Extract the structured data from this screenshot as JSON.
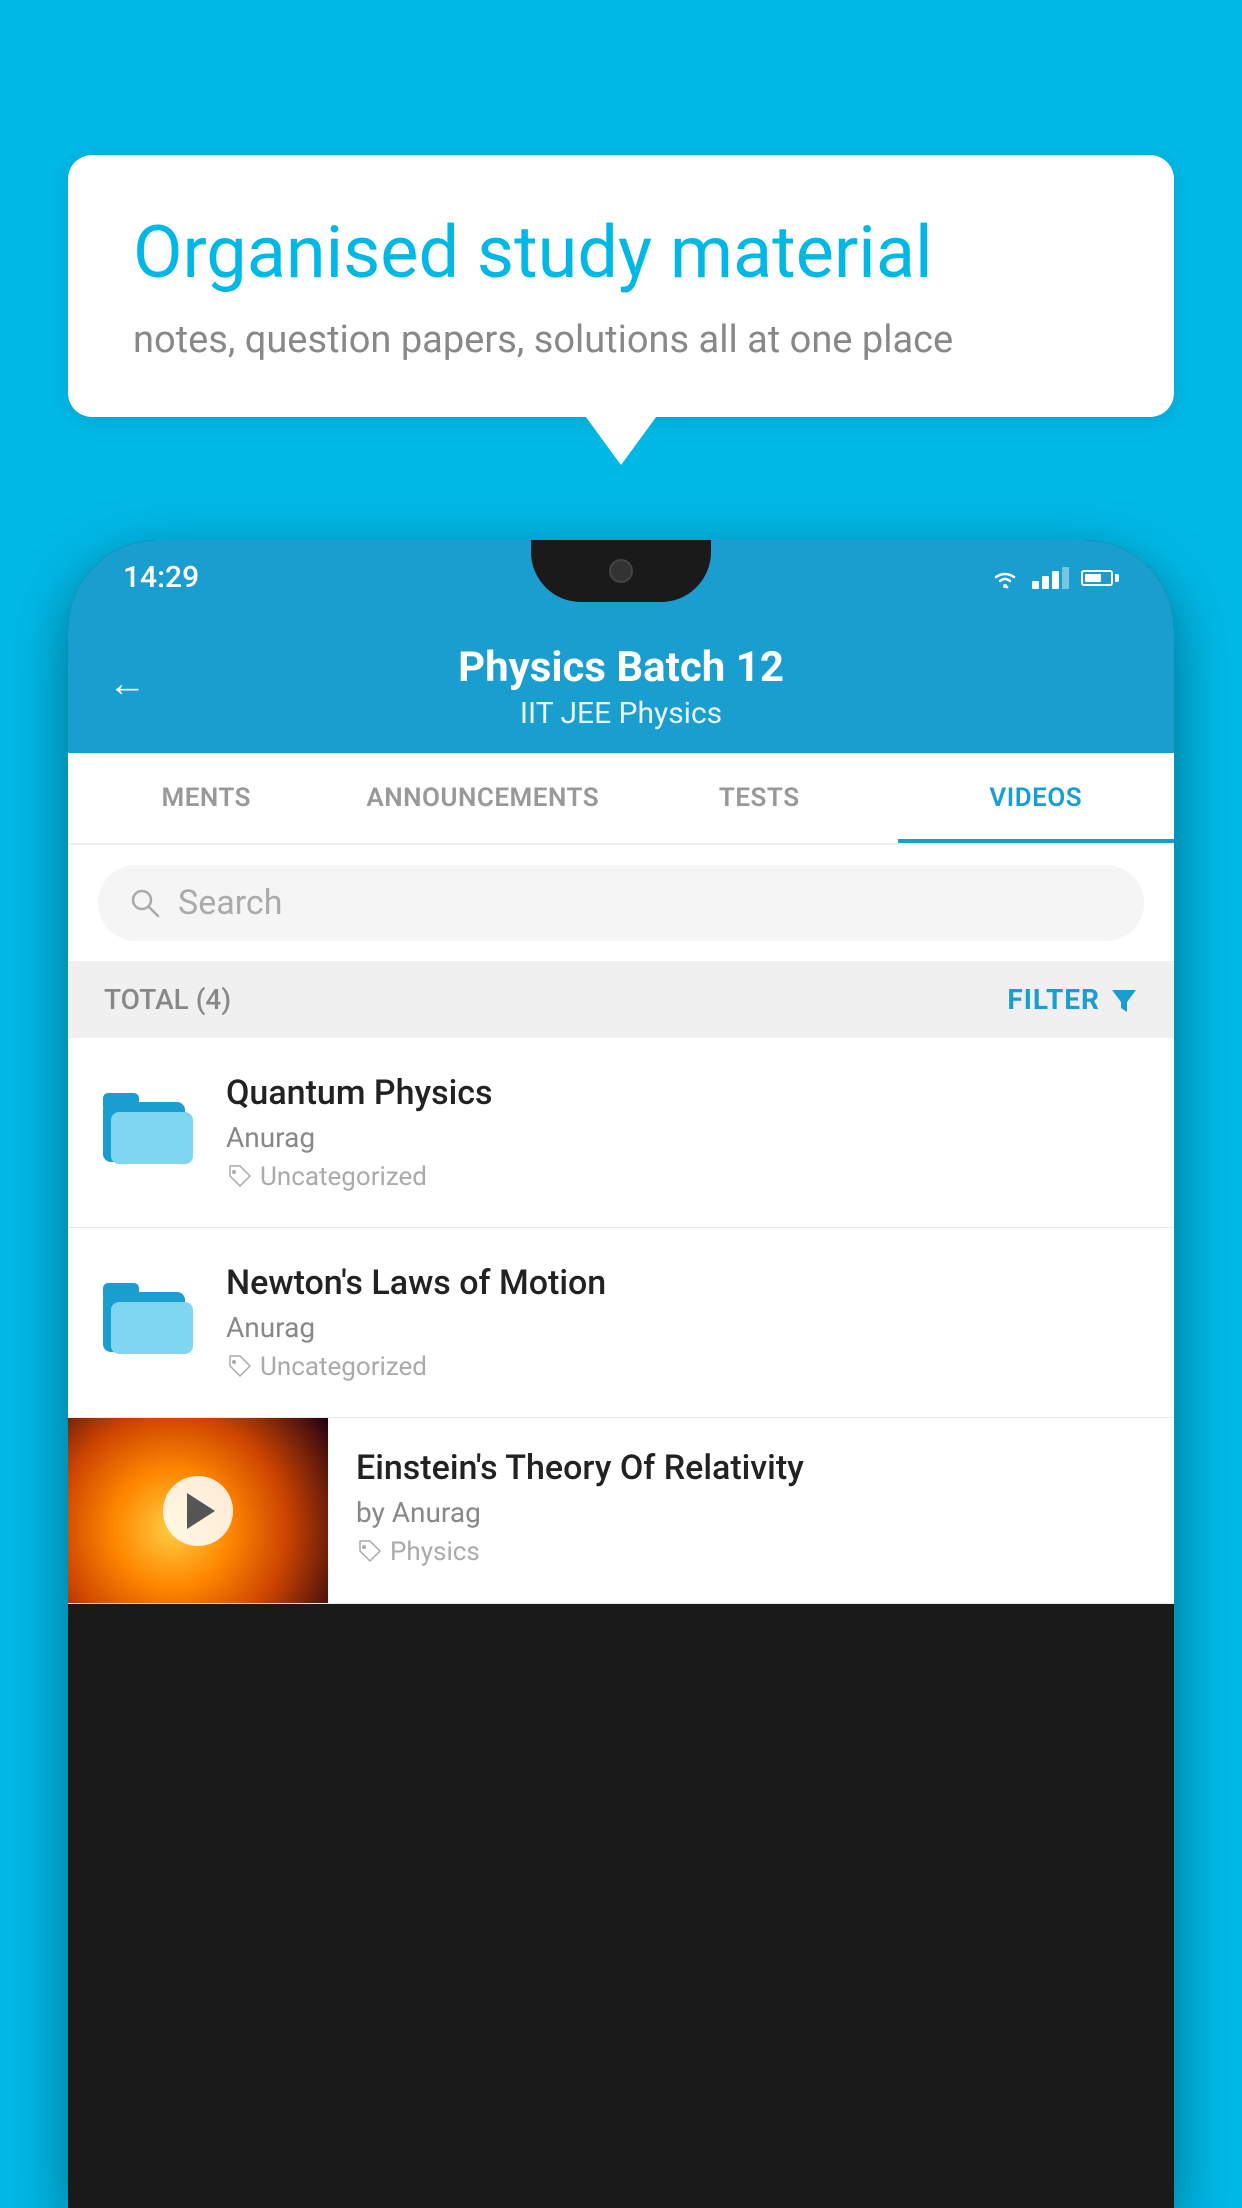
{
  "background_color": "#00b8e6",
  "speech_bubble": {
    "title": "Organised study material",
    "subtitle": "notes, question papers, solutions all at one place"
  },
  "phone": {
    "status_bar": {
      "time": "14:29"
    },
    "header": {
      "back_label": "←",
      "title": "Physics Batch 12",
      "subtitle_tags": "IIT JEE   Physics"
    },
    "tabs": [
      {
        "label": "MENTS",
        "active": false
      },
      {
        "label": "ANNOUNCEMENTS",
        "active": false
      },
      {
        "label": "TESTS",
        "active": false
      },
      {
        "label": "VIDEOS",
        "active": true
      }
    ],
    "search": {
      "placeholder": "Search"
    },
    "filter_bar": {
      "total_label": "TOTAL (4)",
      "filter_label": "FILTER"
    },
    "videos": [
      {
        "title": "Quantum Physics",
        "author": "Anurag",
        "tag": "Uncategorized",
        "type": "folder"
      },
      {
        "title": "Newton's Laws of Motion",
        "author": "Anurag",
        "tag": "Uncategorized",
        "type": "folder"
      },
      {
        "title": "Einstein's Theory Of Relativity",
        "author": "by Anurag",
        "tag": "Physics",
        "type": "video"
      }
    ]
  }
}
